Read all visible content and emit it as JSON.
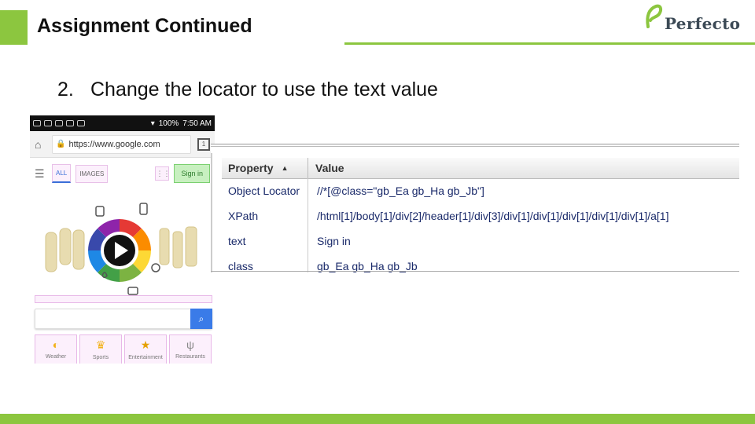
{
  "slide": {
    "title": "Assignment Continued",
    "step_number": "2.",
    "step_text": "Change the locator to use the text value",
    "accent_color": "#8cc63f"
  },
  "logo": {
    "text": "Perfecto",
    "icon": "perfecto-leaf-icon"
  },
  "phone": {
    "status": {
      "battery": "100%",
      "time": "7:50 AM"
    },
    "url": "https://www.google.com",
    "nav": {
      "tab_all": "ALL",
      "tab_images": "IMAGES",
      "sign_in": "Sign in"
    },
    "tiles": [
      {
        "label": "Weather",
        "icon": "weather-icon"
      },
      {
        "label": "Sports",
        "icon": "trophy-icon"
      },
      {
        "label": "Entertainment",
        "icon": "star-icon"
      },
      {
        "label": "Restaurants",
        "icon": "fork-knife-icon"
      }
    ]
  },
  "properties": {
    "headers": {
      "property": "Property",
      "value": "Value"
    },
    "rows": [
      {
        "property": "Object Locator",
        "value": "//*[@class=\"gb_Ea gb_Ha gb_Jb\"]"
      },
      {
        "property": "XPath",
        "value": "/html[1]/body[1]/div[2]/header[1]/div[3]/div[1]/div[1]/div[1]/div[1]/div[1]/a[1]"
      },
      {
        "property": "text",
        "value": "Sign in"
      },
      {
        "property": "class",
        "value": "gb_Ea gb_Ha gb_Jb"
      }
    ]
  }
}
